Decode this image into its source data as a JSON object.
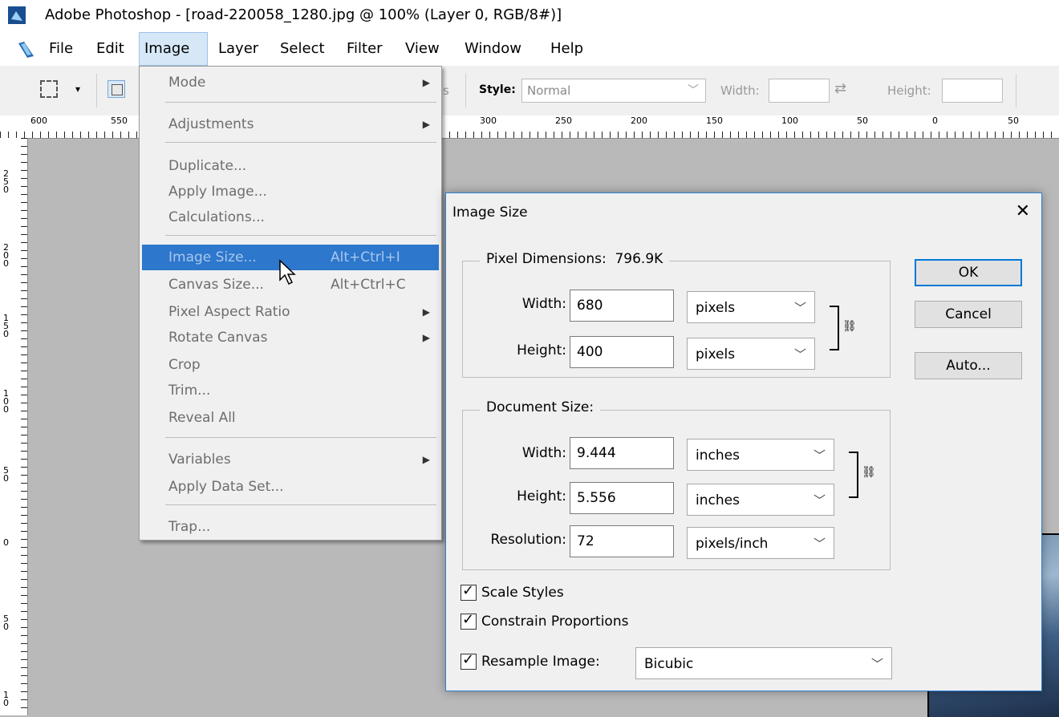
{
  "window": {
    "title": "Adobe Photoshop - [road-220058_1280.jpg @ 100% (Layer 0, RGB/8#)]"
  },
  "menubar": {
    "items": [
      "File",
      "Edit",
      "Image",
      "Layer",
      "Select",
      "Filter",
      "View",
      "Window",
      "Help"
    ],
    "open": "Image"
  },
  "options": {
    "style_label": "Style:",
    "style_value": "Normal",
    "width_label": "Width:",
    "height_label": "Height:",
    "partial_label": "s",
    "chevron": "▾",
    "select_chevron": "﹀",
    "swap": "⇄"
  },
  "ruler": {
    "top_labels": [
      "600",
      "550",
      "300",
      "250",
      "200",
      "150",
      "100",
      "50",
      "0",
      "50"
    ],
    "left_labels": [
      "250",
      "200",
      "150",
      "100",
      "50",
      "0",
      "50",
      "10"
    ]
  },
  "image_menu": {
    "items": [
      {
        "label": "Mode",
        "submenu": true
      },
      {
        "label": "Adjustments",
        "submenu": true
      },
      {
        "label": "Duplicate..."
      },
      {
        "label": "Apply Image..."
      },
      {
        "label": "Calculations..."
      },
      {
        "label": "Image Size...",
        "shortcut": "Alt+Ctrl+I",
        "highlighted": true
      },
      {
        "label": "Canvas Size...",
        "shortcut": "Alt+Ctrl+C"
      },
      {
        "label": "Pixel Aspect Ratio",
        "submenu": true
      },
      {
        "label": "Rotate Canvas",
        "submenu": true
      },
      {
        "label": "Crop"
      },
      {
        "label": "Trim..."
      },
      {
        "label": "Reveal All"
      },
      {
        "label": "Variables",
        "submenu": true
      },
      {
        "label": "Apply Data Set..."
      },
      {
        "label": "Trap..."
      }
    ],
    "submenu_arrow": "▶"
  },
  "dialog": {
    "title": "Image Size",
    "close": "✕",
    "pixel_dimensions": {
      "title": "Pixel Dimensions:",
      "size": "796.9K",
      "width_label": "Width:",
      "width_value": "680",
      "width_unit": "pixels",
      "height_label": "Height:",
      "height_value": "400",
      "height_unit": "pixels"
    },
    "document_size": {
      "title": "Document Size:",
      "width_label": "Width:",
      "width_value": "9.444",
      "width_unit": "inches",
      "height_label": "Height:",
      "height_value": "5.556",
      "height_unit": "inches",
      "resolution_label": "Resolution:",
      "resolution_value": "72",
      "resolution_unit": "pixels/inch"
    },
    "buttons": {
      "ok": "OK",
      "cancel": "Cancel",
      "auto": "Auto..."
    },
    "checkboxes": {
      "scale_styles": {
        "label": "Scale Styles",
        "checked": true
      },
      "constrain": {
        "label": "Constrain Proportions",
        "checked": true
      },
      "resample": {
        "label": "Resample Image:",
        "checked": true
      }
    },
    "resample_method": "Bicubic",
    "check_mark": "✓",
    "link_glyph": "⛓",
    "chevron": "﹀"
  }
}
